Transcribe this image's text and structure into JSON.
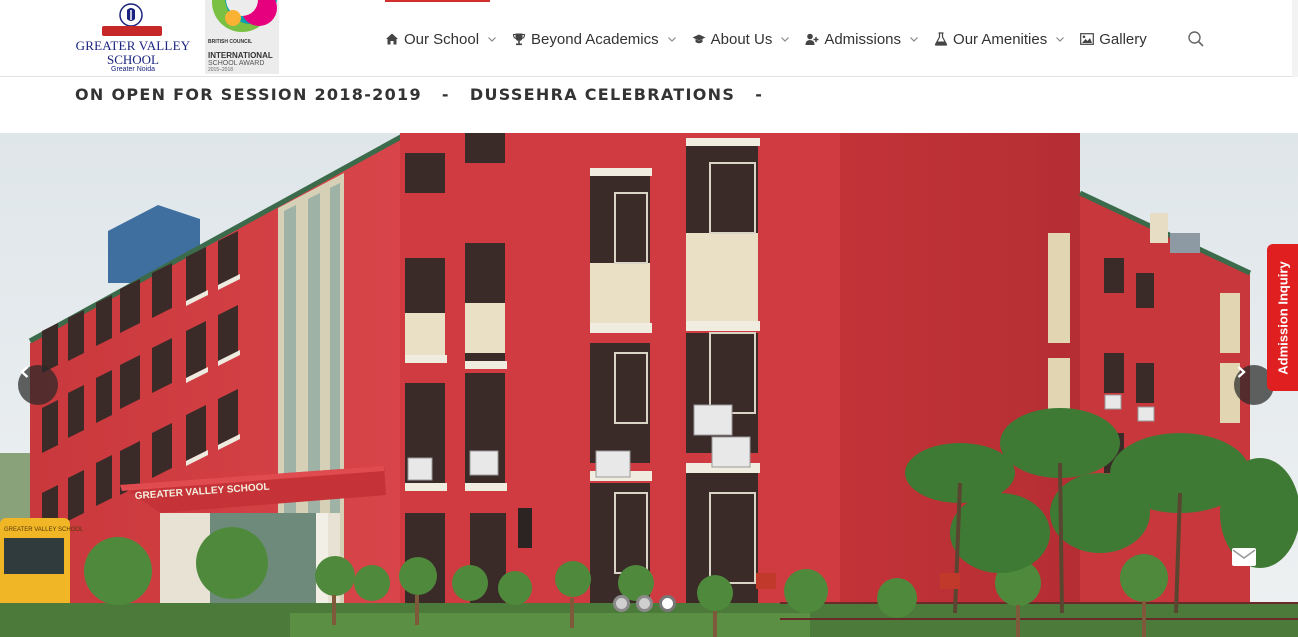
{
  "brand": {
    "school_line1": "GREATER VALLEY",
    "school_line2": "SCHOOL",
    "school_location": "Greater Noida",
    "award_org": "BRITISH COUNCIL",
    "award_title": "INTERNATIONAL",
    "award_subtitle": "SCHOOL AWARD",
    "award_years": "2015–2018"
  },
  "nav": {
    "items": [
      {
        "label": "Our School",
        "icon": "home-icon",
        "dropdown": true
      },
      {
        "label": "Beyond Academics",
        "icon": "trophy-icon",
        "dropdown": true
      },
      {
        "label": "About Us",
        "icon": "graduation-cap-icon",
        "dropdown": true
      },
      {
        "label": "Admissions",
        "icon": "user-plus-icon",
        "dropdown": true
      },
      {
        "label": "Our Amenities",
        "icon": "flask-icon",
        "dropdown": true
      },
      {
        "label": "Gallery",
        "icon": "picture-icon",
        "dropdown": false
      }
    ],
    "search_icon": "search-icon"
  },
  "ticker": {
    "item1": "ON OPEN FOR SESSION 2018-2019",
    "separator": "-",
    "item2": "DUSSEHRA CELEBRATIONS"
  },
  "hero": {
    "building_sign": "GREATER VALLEY SCHOOL",
    "roof_sign": "GREATER VALLEY SCHOOL",
    "bus_text": "GREATER VALLEY SCHOOL",
    "slides_count": 3,
    "active_slide": 3,
    "prev_icon": "chevron-left-icon",
    "next_icon": "chevron-right-icon"
  },
  "widgets": {
    "admission_inquiry": "Admission Inquiry",
    "mail_icon": "envelope-icon"
  },
  "colors": {
    "accent": "#d32f2f",
    "building": "#d0393a",
    "inquiry_tab": "#e02020",
    "nav_text": "#333333"
  }
}
